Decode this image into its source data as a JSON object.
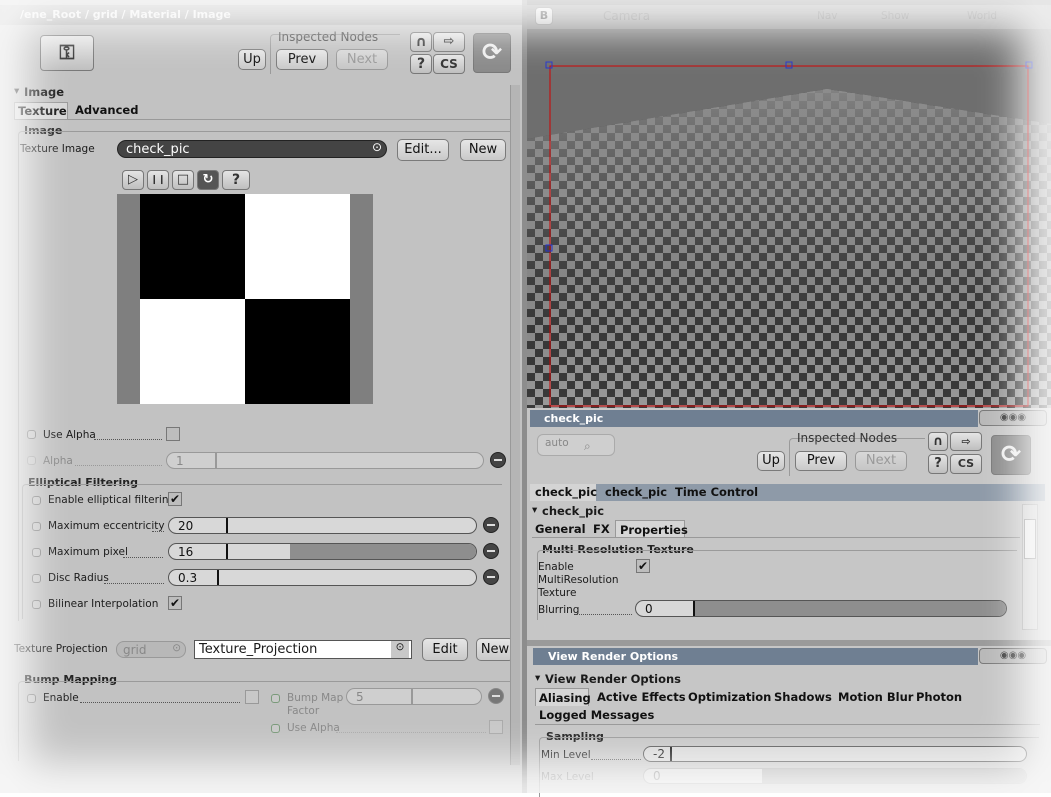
{
  "left": {
    "title": "/ene_Root / grid / Material / Image",
    "nav": {
      "inspected_nodes": "Inspected Nodes",
      "up": "Up",
      "prev": "Prev",
      "next": "Next"
    },
    "section_image": "Image",
    "tabs": [
      "Texture",
      "Advanced"
    ],
    "image_group": "Image",
    "texture_image_label": "Texture Image",
    "texture_image_value": "check_pic",
    "edit": "Edit...",
    "new": "New",
    "use_alpha": "Use Alpha",
    "alpha_label": "Alpha",
    "alpha_value": "1",
    "elliptical": {
      "title": "Elliptical Filtering",
      "enable_label": "Enable elliptical filtering",
      "max_ecc_label": "Maximum eccentricity",
      "max_ecc_value": "20",
      "max_pixel_label": "Maximum pixel",
      "max_pixel_value": "16",
      "disc_radius_label": "Disc Radius",
      "disc_radius_value": "0.3",
      "bilinear_label": "Bilinear Interpolation"
    },
    "projection": {
      "label": "Texture Projection",
      "combo": "grid",
      "value": "Texture_Projection",
      "edit": "Edit",
      "new": "New"
    },
    "bump": {
      "title": "Bump Mapping",
      "enable": "Enable",
      "factor_label1": "Bump Map",
      "factor_label2": "Factor",
      "factor_value": "5",
      "use_alpha": "Use Alpha"
    }
  },
  "viewport": {
    "camera": "Camera",
    "b": "B",
    "nav": "Nav",
    "show": "Show",
    "world": "World"
  },
  "property": {
    "title": "check_pic",
    "auto": "auto",
    "nav": {
      "inspected_nodes": "Inspected Nodes",
      "up": "Up",
      "prev": "Prev",
      "next": "Next"
    },
    "tabs": [
      "check_pic",
      "check_pic",
      "Time Control"
    ],
    "node": "check_pic",
    "subtabs": [
      "General",
      "FX",
      "Properties"
    ],
    "group": "Multi Resolution Texture",
    "enable_label1": "Enable",
    "enable_label2": "MultiResolution",
    "enable_label3": "Texture",
    "blurring_label": "Blurring",
    "blurring_value": "0"
  },
  "render": {
    "title": "View Render Options",
    "node": "View Render Options",
    "tabs": [
      "Aliasing",
      "Active Effects",
      "Optimization",
      "Shadows",
      "Motion Blur",
      "Photon"
    ],
    "tabs2": [
      "Logged Messages"
    ],
    "group": "Sampling",
    "min_label": "Min Level",
    "min_value": "-2",
    "max_label": "Max Level",
    "max_value": "0"
  },
  "icons": {
    "play": "▷",
    "pause": "❙❙",
    "stop": "□",
    "loop": "↻",
    "help": "?"
  },
  "colors": {
    "title_bar": "#6f7f92",
    "panel": "#c4c4c4",
    "selection_red": "#d00000",
    "handle_blue": "#2233cc"
  }
}
